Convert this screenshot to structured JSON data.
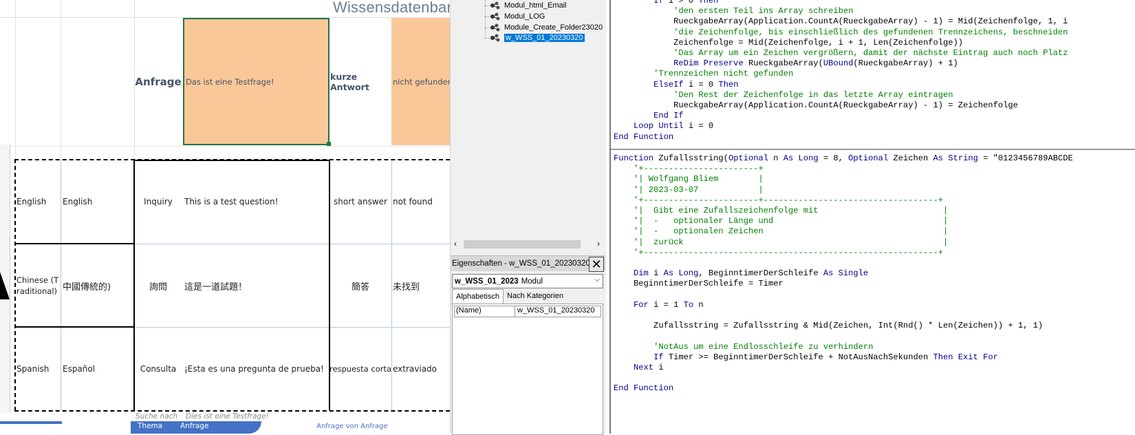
{
  "excel": {
    "title_partial": "Wissensdatenbar",
    "header_row": {
      "anfrage_label": "Anfrage",
      "anfrage_value": "Das ist eine Testfrage!",
      "short_answer_label": "kurze Antwort",
      "short_answer_value": "nicht gefunden"
    },
    "rows": [
      {
        "lang": "English",
        "lang_native": "English",
        "inquiry": "Inquiry",
        "question": "This is a test question!",
        "short_answer": "short answer",
        "result": "not found"
      },
      {
        "lang": "Chinese (Traditional)",
        "lang_native": "中國傳統的)",
        "inquiry": "詢問",
        "question": "這是一道試題！",
        "short_answer": "簡答",
        "result": "未找到"
      },
      {
        "lang": "Spanish",
        "lang_native": "Español",
        "inquiry": "Consulta",
        "question": "¡Esta es una pregunta de prueba!",
        "short_answer": "respuesta corta",
        "result": "extraviado"
      }
    ],
    "footer_cells": [
      "Suche nach",
      "Dies ist eine Testfrage!"
    ],
    "footer_strip": [
      "Thema",
      "Anfrage"
    ],
    "footer_trailing": "Anfrage von  Anfrage"
  },
  "project_tree": {
    "items": [
      "Modul_html_Email",
      "Modul_LOG",
      "Module_Create_Folder23020",
      "w_WSS_01_20230320"
    ],
    "selected_index": 3
  },
  "properties": {
    "title": "Eigenschaften - w_WSS_01_20230320",
    "close_symbol": "✕",
    "object_name": "w_WSS_01_2023",
    "object_type": "Modul",
    "tabs": [
      "Alphabetisch",
      "Nach Kategorien"
    ],
    "active_tab": 0,
    "grid": [
      {
        "name": "(Name)",
        "value": "w_WSS_01_20230320"
      }
    ]
  },
  "code": {
    "top_block": [
      [
        {
          "t": "        "
        },
        {
          "t": "If",
          "c": "kw"
        },
        {
          "t": " i > 0 "
        },
        {
          "t": "Then",
          "c": "kw"
        }
      ],
      [
        {
          "t": "            "
        },
        {
          "t": "'den ersten Teil ins Array schreiben",
          "c": "cm"
        }
      ],
      [
        {
          "t": "            RueckgabeArray(Application.CountA(RueckgabeArray) - 1) = Mid(Zeichenfolge, 1, i"
        }
      ],
      [
        {
          "t": "            "
        },
        {
          "t": "'die Zeichenfolge, bis einschließlich des gefundenen Trennzeichens, beschneiden",
          "c": "cm"
        }
      ],
      [
        {
          "t": "            Zeichenfolge = Mid(Zeichenfolge, i + 1, Len(Zeichenfolge))"
        }
      ],
      [
        {
          "t": "            "
        },
        {
          "t": "'Das Array um ein Zeichen vergrößern, damit der nächste Eintrag auch noch Platz",
          "c": "cm"
        }
      ],
      [
        {
          "t": "            "
        },
        {
          "t": "ReDim Preserve",
          "c": "kw"
        },
        {
          "t": " RueckgabeArray("
        },
        {
          "t": "UBound",
          "c": "kw"
        },
        {
          "t": "(RueckgabeArray) + 1)"
        }
      ],
      [
        {
          "t": "        "
        },
        {
          "t": "'Trennzeichen nicht gefunden",
          "c": "cm"
        }
      ],
      [
        {
          "t": "        "
        },
        {
          "t": "ElseIf",
          "c": "kw"
        },
        {
          "t": " i = 0 "
        },
        {
          "t": "Then",
          "c": "kw"
        }
      ],
      [
        {
          "t": "            "
        },
        {
          "t": "'Den Rest der Zeichenfolge in das letzte Array eintragen",
          "c": "cm"
        }
      ],
      [
        {
          "t": "            RueckgabeArray(Application.CountA(RueckgabeArray) - 1) = Zeichenfolge"
        }
      ],
      [
        {
          "t": "        "
        },
        {
          "t": "End If",
          "c": "kw"
        }
      ],
      [
        {
          "t": "    "
        },
        {
          "t": "Loop Until",
          "c": "kw"
        },
        {
          "t": " i = 0"
        }
      ],
      [
        {
          "t": "End Function",
          "c": "kw"
        }
      ]
    ],
    "bottom_block": [
      [
        {
          "t": "Function",
          "c": "kw"
        },
        {
          "t": " Zufallsstring("
        },
        {
          "t": "Optional",
          "c": "kw"
        },
        {
          "t": " n "
        },
        {
          "t": "As Long",
          "c": "kw"
        },
        {
          "t": " = 8, "
        },
        {
          "t": "Optional",
          "c": "kw"
        },
        {
          "t": " Zeichen "
        },
        {
          "t": "As String",
          "c": "kw"
        },
        {
          "t": " = \"0123456789ABCDE"
        }
      ],
      [
        {
          "t": "    '+-----------------------+",
          "c": "cm"
        }
      ],
      [
        {
          "t": "    '| Wolfgang Bliem        |",
          "c": "cm"
        }
      ],
      [
        {
          "t": "    '| 2023-03-07            |",
          "c": "cm"
        }
      ],
      [
        {
          "t": "    '+-----------------------+-----------------------------------+",
          "c": "cm"
        }
      ],
      [
        {
          "t": "    '|  Gibt eine Zufallszeichenfolge mit                         |",
          "c": "cm"
        }
      ],
      [
        {
          "t": "    '|  -   optionaler Länge und                                  |",
          "c": "cm"
        }
      ],
      [
        {
          "t": "    '|  -   optionalen Zeichen                                    |",
          "c": "cm"
        }
      ],
      [
        {
          "t": "    '|  zurück                                                    |",
          "c": "cm"
        }
      ],
      [
        {
          "t": "    '+-----------------------------------------------------------+",
          "c": "cm"
        }
      ],
      [
        {
          "t": ""
        }
      ],
      [
        {
          "t": "    "
        },
        {
          "t": "Dim",
          "c": "kw"
        },
        {
          "t": " i "
        },
        {
          "t": "As Long",
          "c": "kw"
        },
        {
          "t": ", BeginntimerDerSchleife "
        },
        {
          "t": "As Single",
          "c": "kw"
        }
      ],
      [
        {
          "t": "    BeginntimerDerSchleife = Timer"
        }
      ],
      [
        {
          "t": ""
        }
      ],
      [
        {
          "t": "    "
        },
        {
          "t": "For",
          "c": "kw"
        },
        {
          "t": " i = 1 "
        },
        {
          "t": "To",
          "c": "kw"
        },
        {
          "t": " n"
        }
      ],
      [
        {
          "t": ""
        }
      ],
      [
        {
          "t": "        Zufallsstring = Zufallsstring & Mid(Zeichen, Int(Rnd() * Len(Zeichen)) + 1, 1)"
        }
      ],
      [
        {
          "t": ""
        }
      ],
      [
        {
          "t": "        "
        },
        {
          "t": "'NotAus um eine Endlosschleife zu verhindern",
          "c": "cm"
        }
      ],
      [
        {
          "t": "        "
        },
        {
          "t": "If",
          "c": "kw"
        },
        {
          "t": " Timer >= BeginntimerDerSchleife + NotAusNachSekunden "
        },
        {
          "t": "Then Exit For",
          "c": "kw"
        }
      ],
      [
        {
          "t": "    "
        },
        {
          "t": "Next",
          "c": "kw"
        },
        {
          "t": " i"
        }
      ],
      [
        {
          "t": ""
        }
      ],
      [
        {
          "t": "End Function",
          "c": "kw"
        }
      ]
    ]
  }
}
